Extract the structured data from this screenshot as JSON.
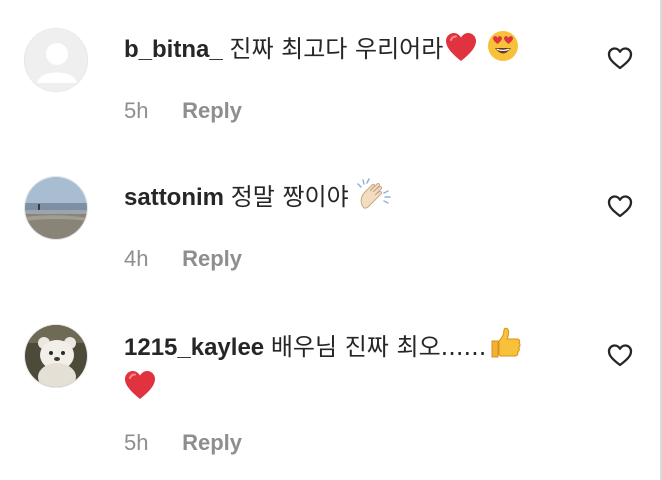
{
  "comments": [
    {
      "username": "b_bitna_",
      "text": "진짜 최고다 우리어라",
      "emojis": [
        "red-heart",
        "heart-eyes-face"
      ],
      "time": "5h",
      "reply_label": "Reply"
    },
    {
      "username": "sattonim",
      "text": "정말 짱이야",
      "emojis": [
        "clapping-hands"
      ],
      "time": "4h",
      "reply_label": "Reply"
    },
    {
      "username": "1215_kaylee",
      "text": "배우님 진짜 최오......",
      "emojis": [
        "thumbs-up",
        "red-heart"
      ],
      "time": "5h",
      "reply_label": "Reply"
    }
  ]
}
